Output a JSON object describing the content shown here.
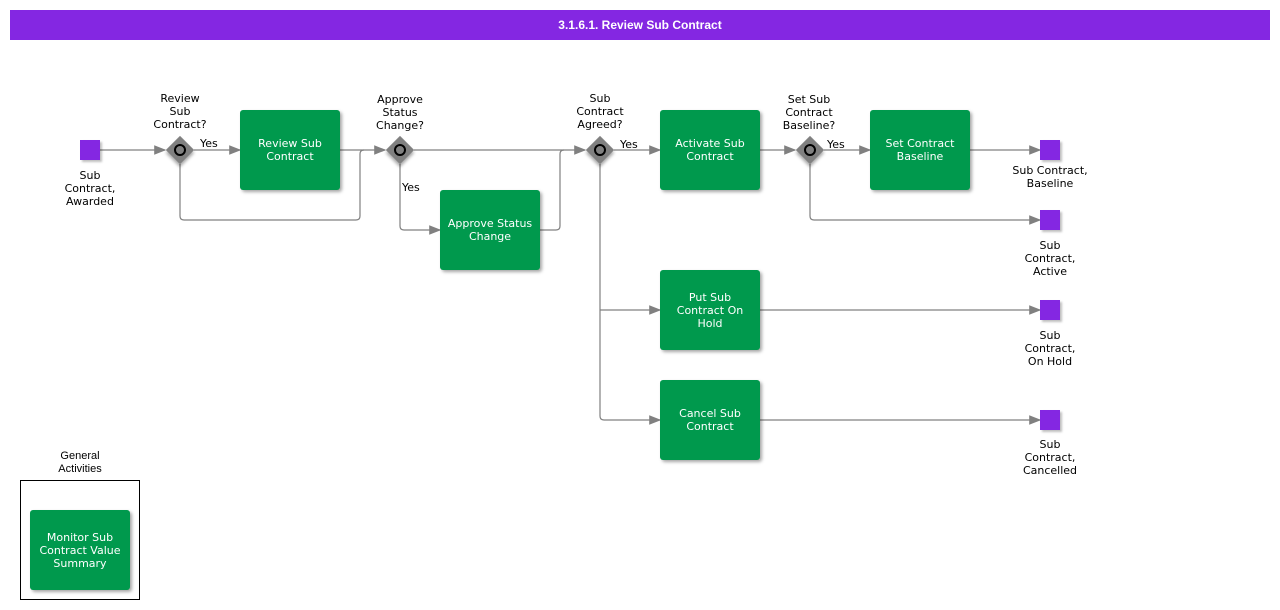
{
  "title": "3.1.6.1. Review Sub Contract",
  "events": {
    "start": "Sub\nContract,\nAwarded",
    "baseline": "Sub Contract,\nBaseline",
    "active": "Sub\nContract,\nActive",
    "on_hold": "Sub\nContract,\nOn Hold",
    "cancelled": "Sub\nContract,\nCancelled"
  },
  "gateways": {
    "review": "Review\nSub\nContract?",
    "approve": "Approve\nStatus\nChange?",
    "agreed": "Sub\nContract\nAgreed?",
    "baseline": "Set Sub\nContract\nBaseline?"
  },
  "tasks": {
    "review": "Review Sub Contract",
    "approve": "Approve Status Change",
    "activate": "Activate Sub Contract",
    "set_baseline": "Set Contract Baseline",
    "on_hold": "Put Sub Contract On Hold",
    "cancel": "Cancel Sub Contract",
    "monitor": "Monitor Sub Contract Value Summary"
  },
  "flow_labels": {
    "yes": "Yes"
  },
  "group": {
    "label": "General\nActivities"
  }
}
